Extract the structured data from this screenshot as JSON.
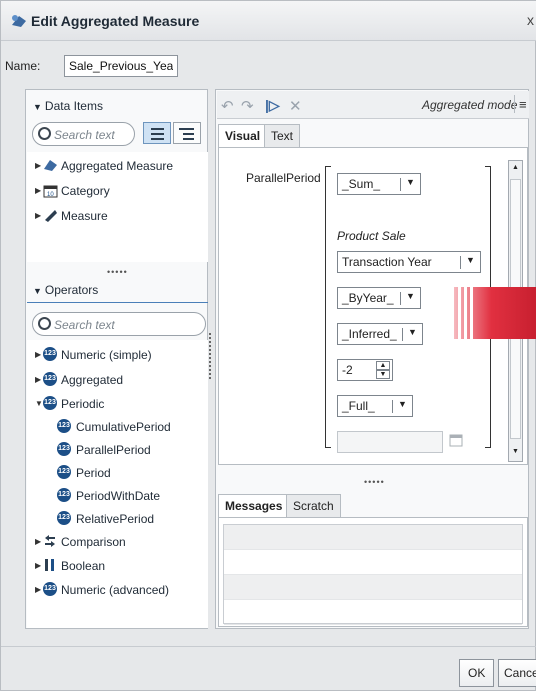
{
  "dialog": {
    "title": "Edit Aggregated Measure",
    "close_label": "x"
  },
  "name_field": {
    "label": "Name:",
    "value": "Sale_Previous_Year"
  },
  "data_items": {
    "header": "Data Items",
    "search_placeholder": "Search text",
    "items": [
      {
        "label": "Aggregated Measure",
        "icon": "aggregated-measure-icon"
      },
      {
        "label": "Category",
        "icon": "calendar-category-icon"
      },
      {
        "label": "Measure",
        "icon": "measure-icon"
      }
    ]
  },
  "operators": {
    "header": "Operators",
    "search_placeholder": "Search text",
    "groups": [
      {
        "label": "Numeric (simple)",
        "expanded": false
      },
      {
        "label": "Aggregated",
        "expanded": false
      },
      {
        "label": "Periodic",
        "expanded": true,
        "children": [
          "CumulativePeriod",
          "ParallelPeriod",
          "Period",
          "PeriodWithDate",
          "RelativePeriod"
        ]
      },
      {
        "label": "Comparison",
        "expanded": false
      },
      {
        "label": "Boolean",
        "expanded": false
      },
      {
        "label": "Numeric (advanced)",
        "expanded": false
      }
    ]
  },
  "toolbar": {
    "mode": "Aggregated mode",
    "icons": [
      "undo-icon",
      "redo-icon",
      "step-icon",
      "delete-icon",
      "menu-icon"
    ]
  },
  "editor": {
    "tabs": [
      "Visual",
      "Text"
    ],
    "active_tab": "Visual",
    "function_name": "ParallelPeriod",
    "aggregation": "_Sum_",
    "measure": "Product Sale",
    "period_field": "Transaction Year",
    "period_type": "_ByYear_",
    "inferred": "_Inferred_",
    "offset": "-2",
    "full": "_Full_",
    "date_value": ""
  },
  "messages": {
    "tabs": [
      "Messages",
      "Scratch"
    ],
    "active_tab": "Messages"
  },
  "buttons": {
    "ok": "OK",
    "cancel": "Cance"
  },
  "colors": {
    "accent": "#1c4f87",
    "selected": "#cfe2f4",
    "red_graphic": "#e13040"
  }
}
